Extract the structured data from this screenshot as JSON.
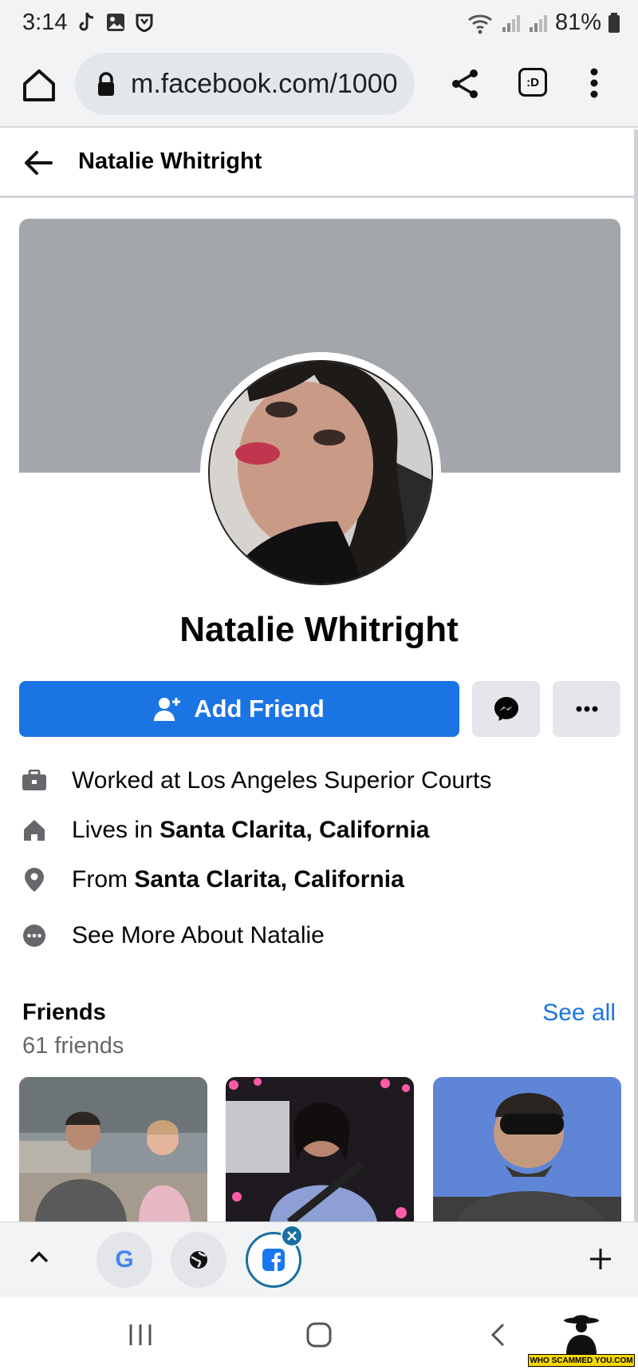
{
  "status_bar": {
    "time": "3:14",
    "battery": "81%"
  },
  "browser": {
    "url": "m.facebook.com/1000"
  },
  "fb_header": {
    "title": "Natalie Whitright"
  },
  "profile": {
    "name": "Natalie Whitright",
    "add_friend_label": "Add Friend",
    "info": {
      "work": "Worked at Los Angeles Superior Courts",
      "lives_prefix": "Lives in ",
      "lives_place": "Santa Clarita, California",
      "from_prefix": "From ",
      "from_place": "Santa Clarita, California",
      "see_more": "See More About Natalie"
    }
  },
  "friends": {
    "title": "Friends",
    "see_all": "See all",
    "count": "61 friends"
  },
  "watermark": {
    "text": "WHO SCAMMED YOU.COM"
  },
  "colors": {
    "fb_blue": "#1b74e4",
    "cover_gray": "#a3a6ab",
    "button_gray": "#e4e6eb",
    "watermark_yellow": "#f7d800"
  }
}
